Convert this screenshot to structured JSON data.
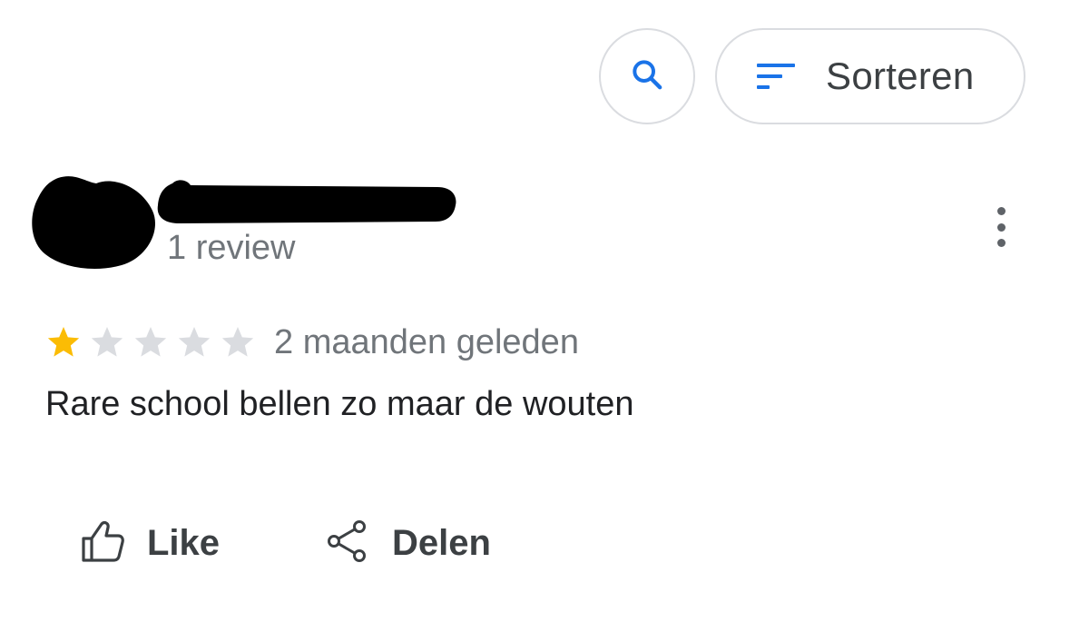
{
  "toolbar": {
    "search_icon": "search-icon",
    "sort_icon": "sort-lines-icon",
    "sort_label": "Sorteren"
  },
  "review": {
    "reviewer_count": "1 review",
    "rating": 1,
    "rating_max": 5,
    "time_ago": "2 maanden geleden",
    "text": "Rare school bellen zo maar de wouten",
    "more_icon": "more-vert-icon"
  },
  "actions": {
    "like_label": "Like",
    "like_icon": "thumb-up-icon",
    "share_label": "Delen",
    "share_icon": "share-icon"
  },
  "colors": {
    "accent_blue": "#1a73e8",
    "star_filled": "#fbbc04",
    "star_empty": "#dadce0",
    "border": "#dadce0",
    "secondary_text": "#70757a",
    "primary_text": "#202124"
  }
}
